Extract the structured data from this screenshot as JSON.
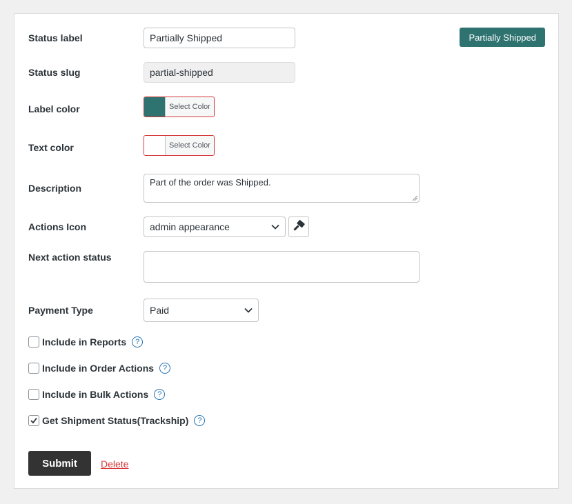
{
  "form": {
    "status_label": {
      "label": "Status label",
      "value": "Partially Shipped"
    },
    "status_slug": {
      "label": "Status slug",
      "value": "partial-shipped"
    },
    "label_color": {
      "label": "Label color",
      "button": "Select Color",
      "color": "#2e7370"
    },
    "text_color": {
      "label": "Text color",
      "button": "Select Color",
      "color": "#ffffff"
    },
    "description": {
      "label": "Description",
      "value": "Part of the order was Shipped."
    },
    "actions_icon": {
      "label": "Actions Icon",
      "value": "admin appearance",
      "icon": "paint-brush-icon"
    },
    "next_action_status": {
      "label": "Next action status",
      "value": ""
    },
    "payment_type": {
      "label": "Payment Type",
      "value": "Paid"
    },
    "checkboxes": [
      {
        "label": "Include in Reports",
        "checked": false
      },
      {
        "label": "Include in Order Actions",
        "checked": false
      },
      {
        "label": "Include in Bulk Actions",
        "checked": false
      },
      {
        "label": "Get Shipment Status(Trackship)",
        "checked": true
      }
    ],
    "help_glyph": "?",
    "submit_label": "Submit",
    "delete_label": "Delete"
  },
  "preview_badge": {
    "text": "Partially Shipped",
    "background": "#2e7370",
    "color": "#ffffff"
  }
}
